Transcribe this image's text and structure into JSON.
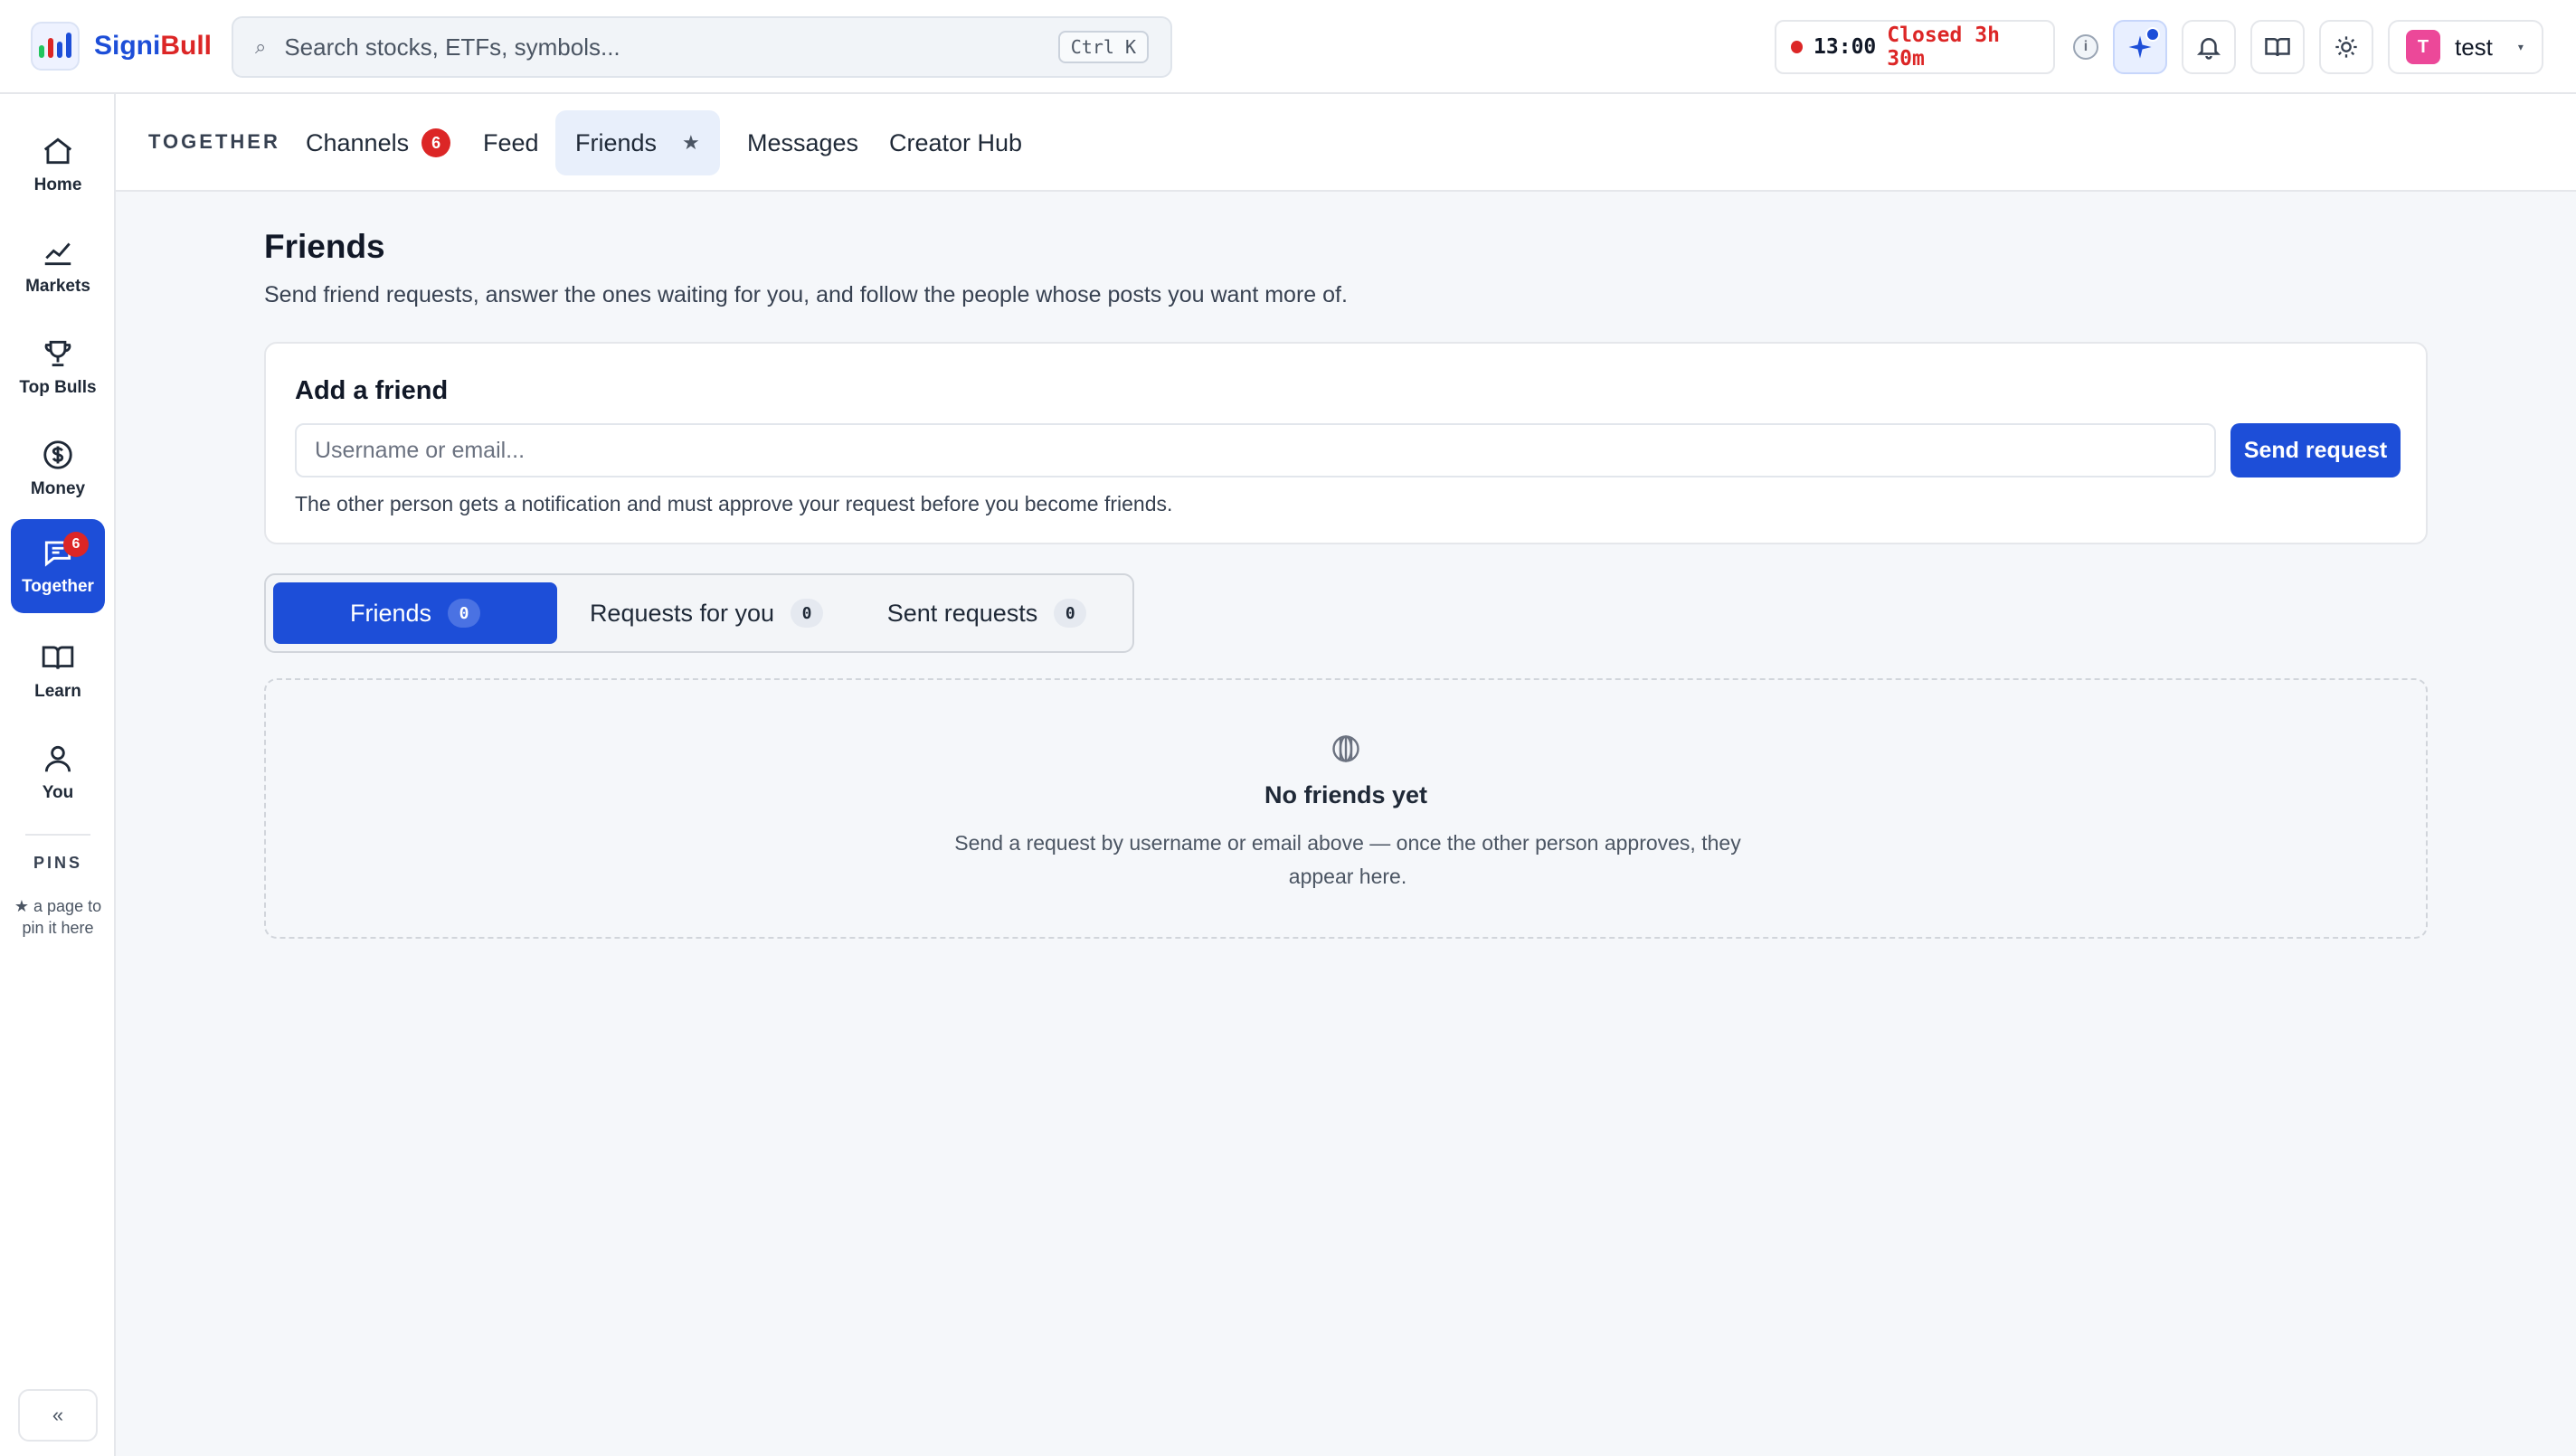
{
  "app": {
    "name_primary": "Signi",
    "name_accent": "Bull",
    "logo_colors": [
      "#1d4ed8",
      "#dc2626",
      "#22c55e",
      "#f59e0b"
    ]
  },
  "search": {
    "placeholder": "Search stocks, ETFs, symbols...",
    "shortcut": "Ctrl K",
    "icon": "search-icon"
  },
  "market": {
    "time": "13:00",
    "status": "Closed 3h 30m",
    "status_color": "#dc2626"
  },
  "header": {
    "info_label": "i",
    "user_initial": "T",
    "user_name": "test"
  },
  "sidebar": {
    "items": [
      {
        "label": "Home",
        "icon": "home-icon"
      },
      {
        "label": "Markets",
        "icon": "chart-line-icon"
      },
      {
        "label": "Top Bulls",
        "icon": "trophy-icon"
      },
      {
        "label": "Money",
        "icon": "dollar-coin-icon"
      },
      {
        "label": "Together",
        "icon": "chat-icon",
        "badge": "6",
        "active": true
      },
      {
        "label": "Learn",
        "icon": "book-icon"
      },
      {
        "label": "You",
        "icon": "user-icon"
      }
    ],
    "pins_title": "PINS",
    "pins_hint": "★ a page to pin it here",
    "collapse_label": "«"
  },
  "subnav": {
    "title": "TOGETHER",
    "tabs": [
      {
        "label": "Channels",
        "badge": "6"
      },
      {
        "label": "Feed"
      },
      {
        "label": "Friends",
        "active": true,
        "pin": "★"
      },
      {
        "label": "Messages"
      },
      {
        "label": "Creator Hub"
      }
    ]
  },
  "main": {
    "title": "Friends",
    "subtitle": "Send friend requests, answer the ones waiting for you, and follow the people whose posts you want more of.",
    "add_friend": {
      "title": "Add a friend",
      "input_placeholder": "Username or email...",
      "button_label": "Send request",
      "note": "The other person gets a notification and must approve your request before you become friends."
    },
    "segments": [
      {
        "label": "Friends",
        "count": "0",
        "active": true
      },
      {
        "label": "Requests for you",
        "count": "0"
      },
      {
        "label": "Sent requests",
        "count": "0"
      }
    ],
    "empty": {
      "icon": "globe-icon",
      "title": "No friends yet",
      "text": "Send a request by username or email above — once the other person approves, they appear here."
    }
  },
  "colors": {
    "accent": "#1d4ed8",
    "badge": "#dc2626",
    "background": "#f5f7fa"
  }
}
